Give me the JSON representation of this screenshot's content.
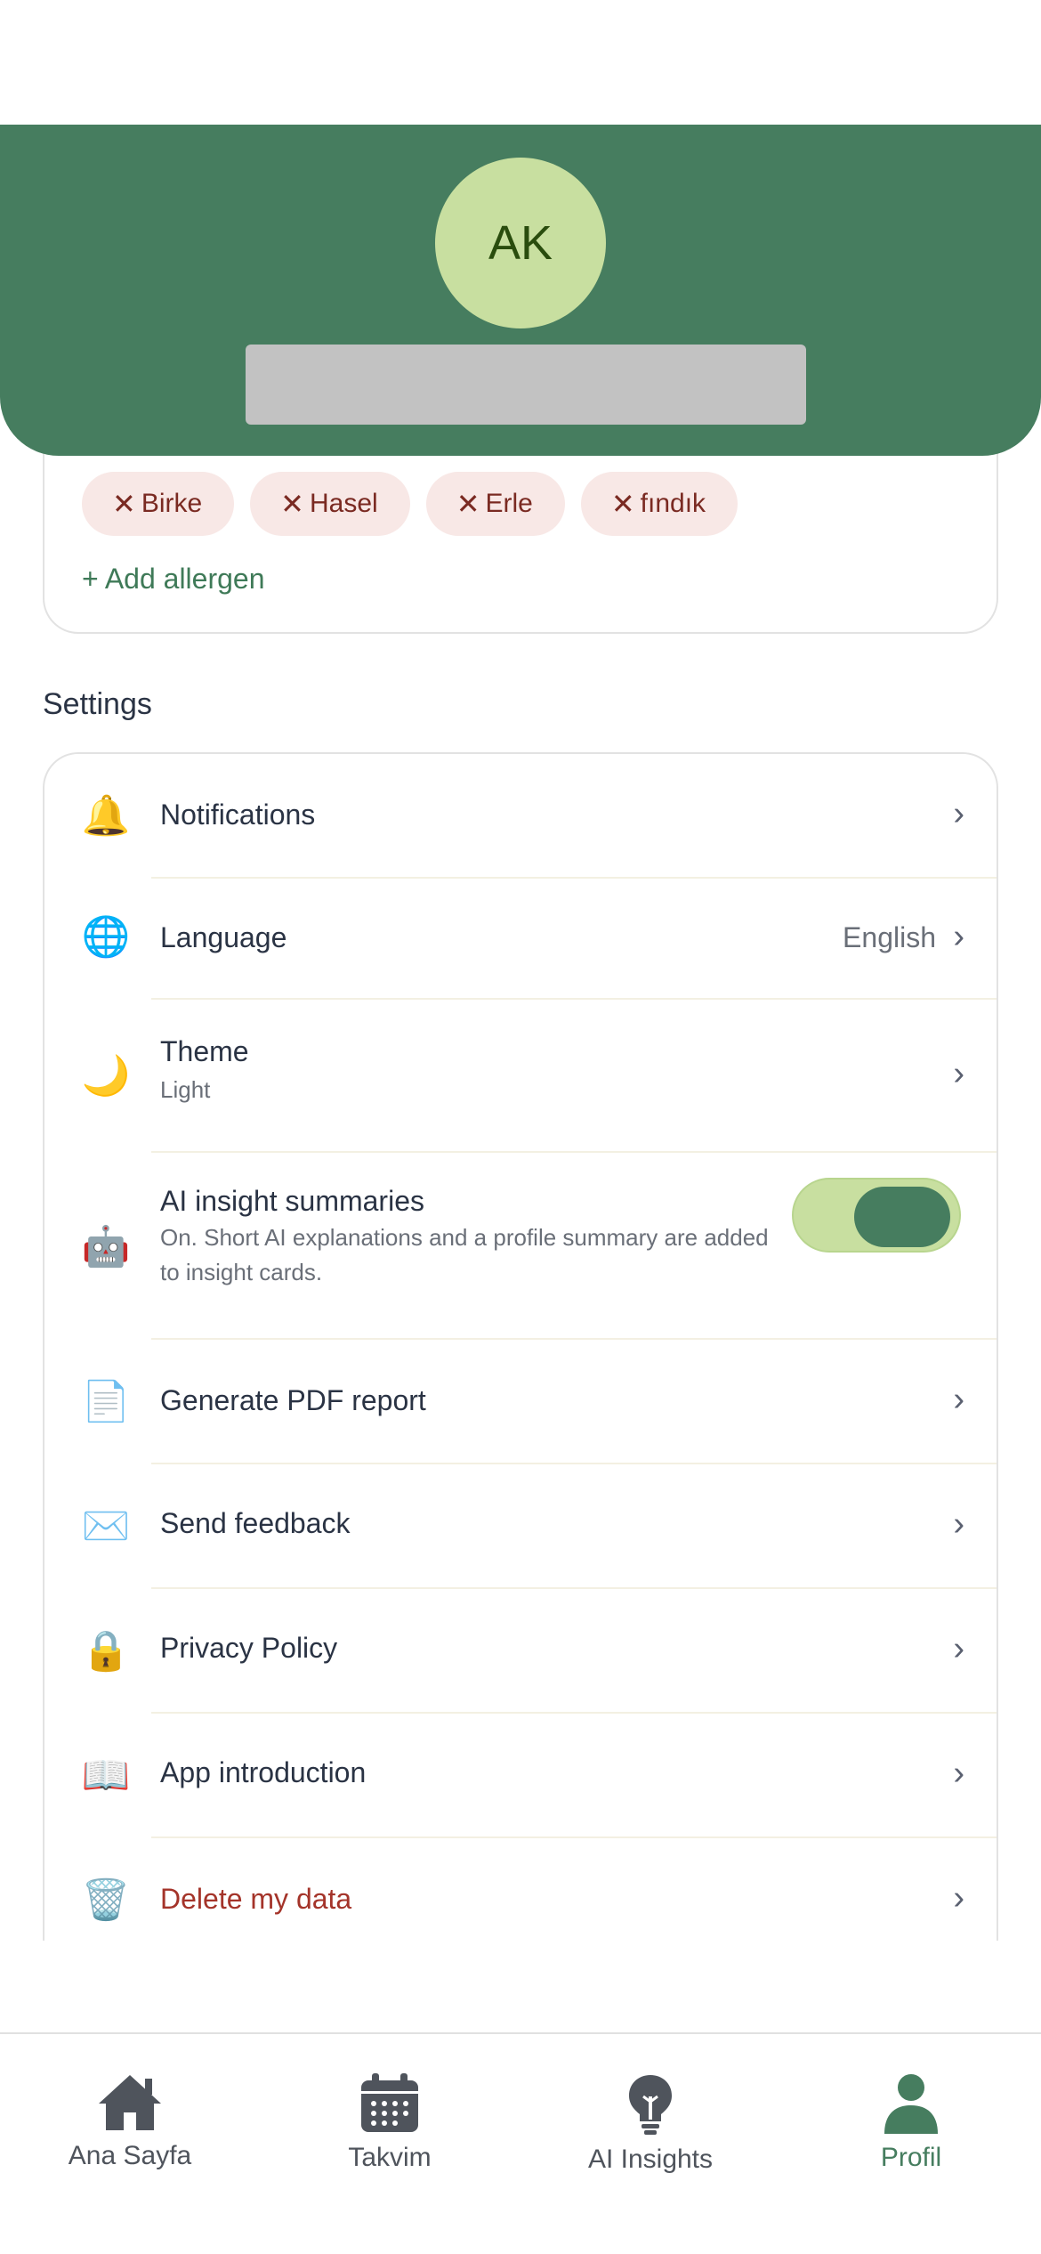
{
  "header": {
    "avatar_initials": "AK"
  },
  "allergens": {
    "chips": [
      "Birke",
      "Hasel",
      "Erle",
      "fındık"
    ],
    "remove_glyph": "✕",
    "add_label": "+ Add allergen"
  },
  "settings": {
    "title": "Settings",
    "items": [
      {
        "icon": "bell-icon",
        "glyph": "🔔",
        "label": "Notifications"
      },
      {
        "icon": "globe-icon",
        "glyph": "🌐",
        "label": "Language",
        "value": "English"
      },
      {
        "icon": "moon-icon",
        "glyph": "🌙",
        "label": "Theme",
        "sub": "Light"
      },
      {
        "icon": "robot-icon",
        "glyph": "🤖",
        "label": "AI insight summaries",
        "sub": "On. Short AI explanations and a profile summary are added to insight cards.",
        "toggle_on": true
      },
      {
        "icon": "document-icon",
        "glyph": "📄",
        "label": "Generate PDF report"
      },
      {
        "icon": "envelope-icon",
        "glyph": "✉️",
        "label": "Send feedback"
      },
      {
        "icon": "lock-icon",
        "glyph": "🔒",
        "label": "Privacy Policy"
      },
      {
        "icon": "book-icon",
        "glyph": "📖",
        "label": "App introduction"
      },
      {
        "icon": "trash-icon",
        "glyph": "🗑️",
        "label": "Delete my data"
      }
    ],
    "chevron": "›"
  },
  "nav": {
    "items": [
      {
        "icon": "home-icon",
        "label": "Ana Sayfa"
      },
      {
        "icon": "calendar-icon",
        "label": "Takvim"
      },
      {
        "icon": "lightbulb-icon",
        "label": "AI Insights"
      },
      {
        "icon": "person-icon",
        "label": "Profil"
      }
    ],
    "active_index": 3
  },
  "colors": {
    "brand": "#467d5f",
    "accent_light": "#c8dfa0",
    "danger": "#a4342a",
    "chip_bg": "#f8e8e6"
  }
}
